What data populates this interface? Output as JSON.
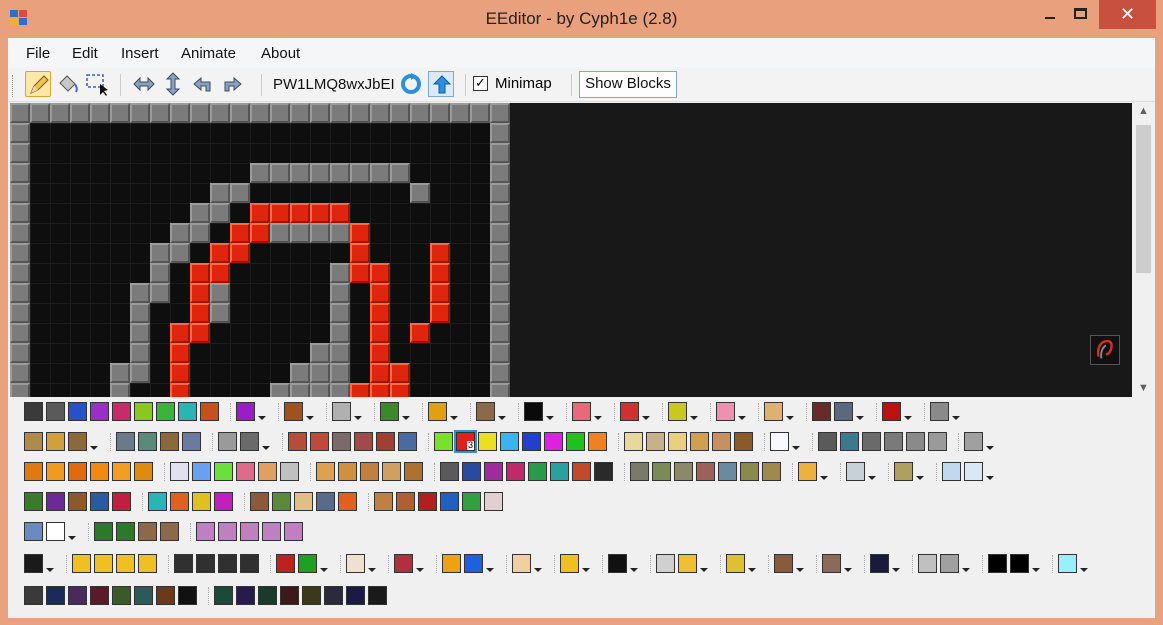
{
  "window": {
    "title": "EEditor - by Cyph1e (2.8)",
    "close_glyph": "✕"
  },
  "menu": [
    "File",
    "Edit",
    "Insert",
    "Animate",
    "About"
  ],
  "toolbar": {
    "tools": [
      {
        "name": "pencil-icon",
        "active": true
      },
      {
        "name": "fill-bucket-icon",
        "active": false
      },
      {
        "name": "selection-icon",
        "active": false
      },
      {
        "name": "flip-horizontal-icon",
        "active": false
      },
      {
        "name": "flip-vertical-icon",
        "active": false
      },
      {
        "name": "rotate-left-icon",
        "active": false
      },
      {
        "name": "rotate-right-icon",
        "active": false
      }
    ],
    "world_code": "PW1LMQ8wxJbEI",
    "reload_icon": "refresh-icon",
    "upload_icon": "upload-icon",
    "minimap_checked": true,
    "minimap_check_glyph": "✓",
    "minimap_label": "Minimap",
    "show_blocks_label": "Show Blocks"
  },
  "scrollbar": {
    "up_glyph": "▲",
    "down_glyph": "▼"
  },
  "palette": {
    "selected_block_badge": "3"
  }
}
